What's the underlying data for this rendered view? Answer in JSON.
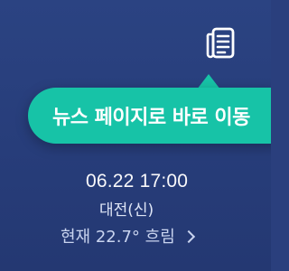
{
  "icons": {
    "news": "news-document-icon"
  },
  "colors": {
    "background": "#2a3f7d",
    "tooltip": "#17c3a7",
    "text": "#ffffff",
    "muted_text": "#c9d4ef"
  },
  "tooltip": {
    "label": "뉴스 페이지로 바로 이동"
  },
  "weather": {
    "datetime": "06.22 17:00",
    "location": "대전(신)",
    "current": "현재 22.7° 흐림"
  }
}
